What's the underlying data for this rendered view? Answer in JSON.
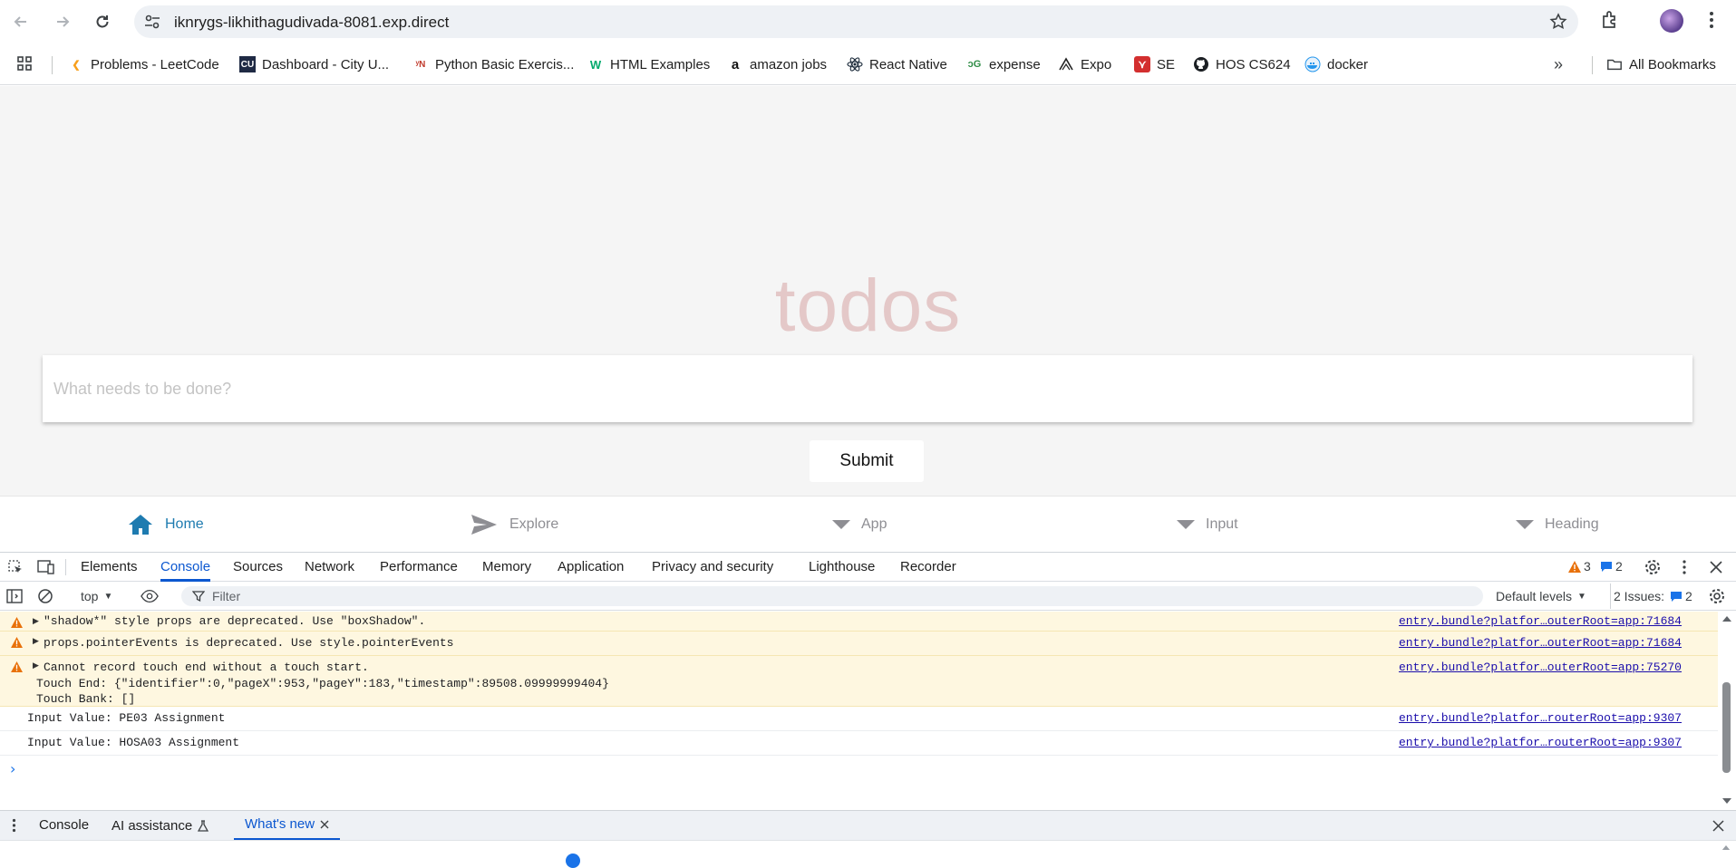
{
  "browser": {
    "url": "iknrygs-likhithagudivada-8081.exp.direct"
  },
  "bookmarks": {
    "items": [
      {
        "label": "Problems - LeetCode",
        "icon": "leetcode-icon"
      },
      {
        "label": "Dashboard - City U...",
        "icon": "cityu-icon"
      },
      {
        "label": "Python Basic Exercis...",
        "icon": "w3resource-icon"
      },
      {
        "label": "HTML Examples",
        "icon": "w3schools-icon"
      },
      {
        "label": "amazon jobs",
        "icon": "amazon-icon"
      },
      {
        "label": "React Native",
        "icon": "react-icon"
      },
      {
        "label": "expense",
        "icon": "gfg-icon"
      },
      {
        "label": "Expo",
        "icon": "expo-icon"
      },
      {
        "label": "SE",
        "icon": "pdf-icon"
      },
      {
        "label": "HOS CS624",
        "icon": "github-icon"
      },
      {
        "label": "docker",
        "icon": "docker-icon"
      }
    ],
    "all_bookmarks": "All Bookmarks"
  },
  "app": {
    "title": "todos",
    "input_placeholder": "What needs to be done?",
    "submit_label": "Submit",
    "tabs": [
      {
        "label": "Home",
        "icon": "home-icon",
        "active": true
      },
      {
        "label": "Explore",
        "icon": "paper-plane-icon",
        "active": false
      },
      {
        "label": "App",
        "icon": "triangle-down-icon",
        "active": false
      },
      {
        "label": "Input",
        "icon": "triangle-down-icon",
        "active": false
      },
      {
        "label": "Heading",
        "icon": "triangle-down-icon",
        "active": false
      }
    ],
    "accent_color": "#1e7bb0"
  },
  "devtools": {
    "tabs": [
      "Elements",
      "Console",
      "Sources",
      "Network",
      "Performance",
      "Memory",
      "Application",
      "Privacy and security",
      "Lighthouse",
      "Recorder"
    ],
    "active_tab": "Console",
    "warning_count": "3",
    "message_count": "2",
    "context": "top",
    "filter_placeholder": "Filter",
    "levels": "Default levels",
    "issues_label": "2 Issues:",
    "issues_count": "2",
    "logs": [
      {
        "type": "warn",
        "message": "\"shadow*\" style props are deprecated. Use \"boxShadow\".",
        "source": "entry.bundle?platfor…outerRoot=app:71684"
      },
      {
        "type": "warn",
        "message": "props.pointerEvents is deprecated. Use style.pointerEvents",
        "source": "entry.bundle?platfor…outerRoot=app:71684"
      },
      {
        "type": "warn",
        "message": "Cannot record touch end without a touch start.",
        "line2": "Touch End: {\"identifier\":0,\"pageX\":953,\"pageY\":183,\"timestamp\":89508.09999999404}",
        "line3": "Touch Bank: []",
        "source": "entry.bundle?platfor…outerRoot=app:75270"
      },
      {
        "type": "log",
        "message": "Input Value: PE03 Assignment",
        "source": "entry.bundle?platfor…routerRoot=app:9307"
      },
      {
        "type": "log",
        "message": "Input Value: HOSA03 Assignment",
        "source": "entry.bundle?platfor…routerRoot=app:9307"
      }
    ],
    "prompt": "›",
    "drawer_tabs": [
      "Console",
      "AI assistance",
      "What's new"
    ],
    "drawer_active": "What's new"
  }
}
